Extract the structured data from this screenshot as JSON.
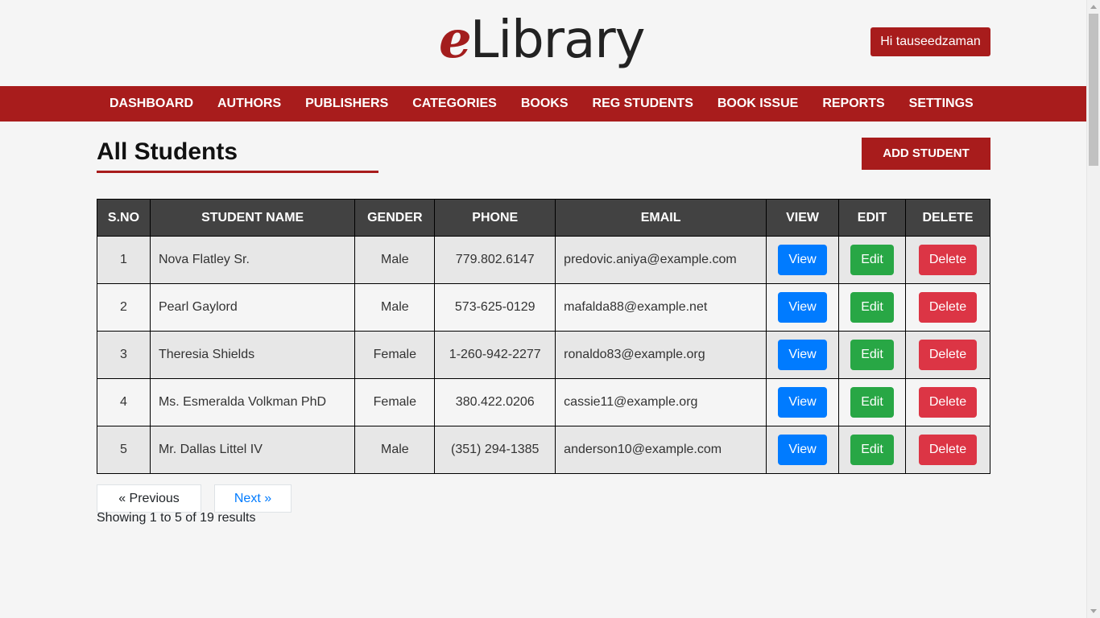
{
  "header": {
    "logo_e": "e",
    "logo_rest": "Library",
    "user_greeting": "Hi tauseedzaman"
  },
  "nav": {
    "items": [
      "DASHBOARD",
      "AUTHORS",
      "PUBLISHERS",
      "CATEGORIES",
      "BOOKS",
      "REG STUDENTS",
      "BOOK ISSUE",
      "REPORTS",
      "SETTINGS"
    ]
  },
  "main": {
    "title": "All Students",
    "add_label": "ADD STUDENT"
  },
  "table": {
    "headers": [
      "S.NO",
      "STUDENT NAME",
      "GENDER",
      "PHONE",
      "EMAIL",
      "VIEW",
      "EDIT",
      "DELETE"
    ],
    "rows": [
      {
        "sno": "1",
        "name": "Nova Flatley Sr.",
        "gender": "Male",
        "phone": "779.802.6147",
        "email": "predovic.aniya@example.com"
      },
      {
        "sno": "2",
        "name": "Pearl Gaylord",
        "gender": "Male",
        "phone": "573-625-0129",
        "email": "mafalda88@example.net"
      },
      {
        "sno": "3",
        "name": "Theresia Shields",
        "gender": "Female",
        "phone": "1-260-942-2277",
        "email": "ronaldo83@example.org"
      },
      {
        "sno": "4",
        "name": "Ms. Esmeralda Volkman PhD",
        "gender": "Female",
        "phone": "380.422.0206",
        "email": "cassie11@example.org"
      },
      {
        "sno": "5",
        "name": "Mr. Dallas Littel IV",
        "gender": "Male",
        "phone": "(351) 294-1385",
        "email": "anderson10@example.com"
      }
    ],
    "view_label": "View",
    "edit_label": "Edit",
    "delete_label": "Delete"
  },
  "pagination": {
    "prev_label": "« Previous",
    "next_label": "Next »",
    "results_text": "Showing 1 to 5 of 19 results"
  },
  "colors": {
    "brand": "#a81c1c",
    "view": "#007bff",
    "edit": "#28a745",
    "delete": "#dc3545",
    "table_header": "#424242"
  }
}
